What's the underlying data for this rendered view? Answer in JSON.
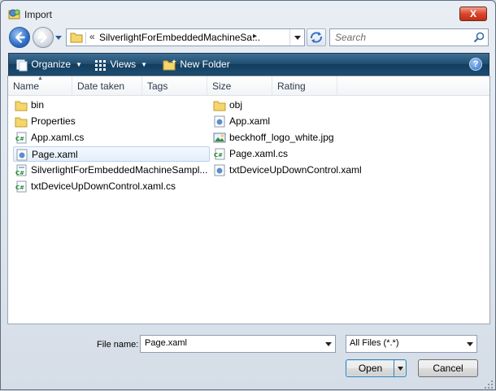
{
  "window": {
    "title": "Import",
    "close_label": "X"
  },
  "nav": {
    "address_chevron": "«",
    "address_path": "SilverlightForEmbeddedMachineSa...",
    "address_arrow": "▸",
    "search_placeholder": "Search"
  },
  "toolbar": {
    "organize_label": "Organize",
    "views_label": "Views",
    "new_folder_label": "New Folder",
    "help_label": "?"
  },
  "columns": [
    "Name",
    "Date taken",
    "Tags",
    "Size",
    "Rating"
  ],
  "files_left": [
    {
      "name": "bin",
      "icon": "folder-icon"
    },
    {
      "name": "Properties",
      "icon": "folder-icon"
    },
    {
      "name": "App.xaml.cs",
      "icon": "csharp-file-icon"
    },
    {
      "name": "Page.xaml",
      "icon": "xaml-file-icon",
      "selected": true
    },
    {
      "name": "SilverlightForEmbeddedMachineSampl...",
      "icon": "csharp-project-icon"
    },
    {
      "name": "txtDeviceUpDownControl.xaml.cs",
      "icon": "csharp-file-icon"
    }
  ],
  "files_right": [
    {
      "name": "obj",
      "icon": "folder-icon"
    },
    {
      "name": "App.xaml",
      "icon": "xaml-file-icon"
    },
    {
      "name": "beckhoff_logo_white.jpg",
      "icon": "image-file-icon"
    },
    {
      "name": "Page.xaml.cs",
      "icon": "csharp-file-icon"
    },
    {
      "name": "txtDeviceUpDownControl.xaml",
      "icon": "xaml-file-icon"
    }
  ],
  "footer": {
    "file_name_label": "File name:",
    "file_name_value": "Page.xaml",
    "file_type_value": "All Files (*.*)",
    "open_label": "Open",
    "cancel_label": "Cancel"
  }
}
